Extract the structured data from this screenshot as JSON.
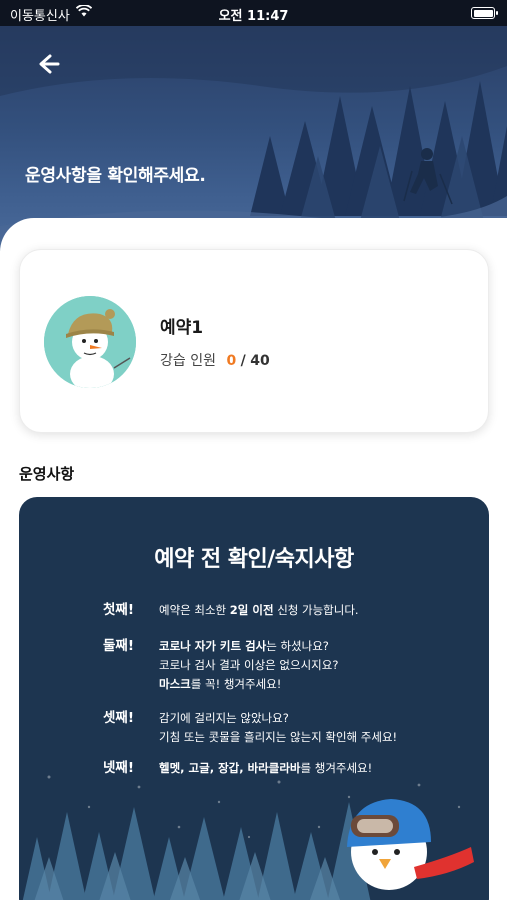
{
  "status_bar": {
    "carrier": "이동통신사",
    "time": "오전 11:47"
  },
  "header": {
    "title": "운영사항을 확인해주세요."
  },
  "profile": {
    "name": "예약1",
    "capacity_label": "강습 인원",
    "capacity_current": "0",
    "capacity_separator": "/",
    "capacity_max": "40"
  },
  "section": {
    "title": "운영사항"
  },
  "notice": {
    "title": "예약 전 확인/숙지사항",
    "rules": [
      {
        "label": "첫째!",
        "lines": [
          {
            "pre": "예약은 최소한 ",
            "bold": "2일 이전",
            "post": " 신청 가능합니다."
          }
        ]
      },
      {
        "label": "둘째!",
        "lines": [
          {
            "pre": "",
            "bold": "코로나 자가 키트 검사",
            "post": "는 하셨나요?"
          },
          {
            "pre": "코로나 검사 결과 이상은 없으시지요?",
            "bold": "",
            "post": ""
          },
          {
            "pre": "",
            "bold": "마스크",
            "post": "를 꼭! 챙겨주세요!"
          }
        ]
      },
      {
        "label": "셋째!",
        "lines": [
          {
            "pre": "감기에 걸리지는 않았나요?",
            "bold": "",
            "post": ""
          },
          {
            "pre": "기침 또는 콧물을 흘리지는 않는지 확인해 주세요!",
            "bold": "",
            "post": ""
          }
        ]
      },
      {
        "label": "넷째!",
        "lines": [
          {
            "pre": "",
            "bold": "헬멧, 고글, 장갑, 바라클라바",
            "post": "를 챙겨주세요!"
          }
        ]
      }
    ]
  },
  "colors": {
    "hero_top": "#2a3f66",
    "notice_bg": "#1d3550",
    "accent_orange": "#f07a22",
    "avatar_bg": "#7fd0c6"
  },
  "icons": {
    "back": "arrow-left-icon",
    "wifi": "wifi-icon",
    "battery": "battery-icon"
  }
}
